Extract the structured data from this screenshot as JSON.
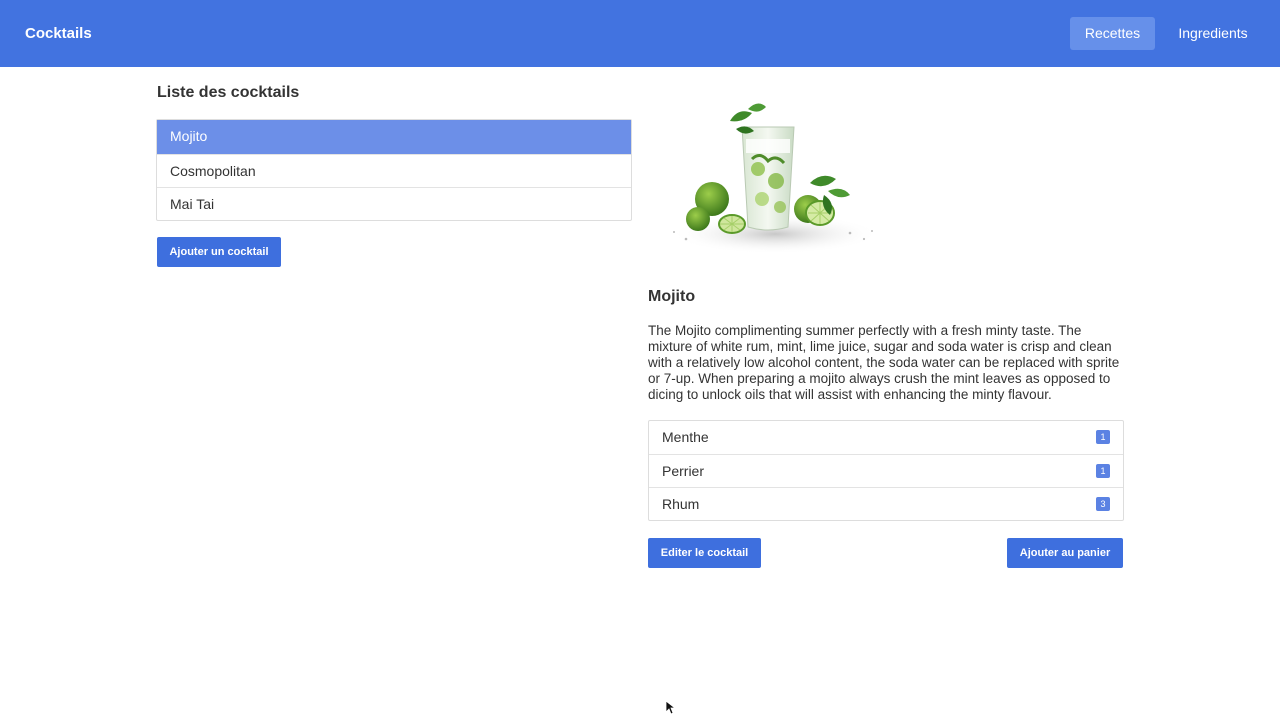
{
  "navbar": {
    "brand": "Cocktails",
    "links": [
      {
        "label": "Recettes",
        "active": true
      },
      {
        "label": "Ingredients",
        "active": false
      }
    ]
  },
  "list": {
    "title": "Liste des cocktails",
    "items": [
      {
        "label": "Mojito",
        "selected": true
      },
      {
        "label": "Cosmopolitan",
        "selected": false
      },
      {
        "label": "Mai Tai",
        "selected": false
      }
    ],
    "add_button": "Ajouter un cocktail"
  },
  "detail": {
    "image_name": "mojito-glass-with-limes",
    "title": "Mojito",
    "description": "The Mojito complimenting summer perfectly with a fresh minty taste. The mixture of white rum, mint, lime juice, sugar and soda water is crisp and clean with a relatively low alcohol content, the soda water can be replaced with sprite or 7-up. When preparing a mojito always crush the mint leaves as opposed to dicing to unlock oils that will assist with enhancing the minty flavour.",
    "ingredients": [
      {
        "name": "Menthe",
        "qty": "1"
      },
      {
        "name": "Perrier",
        "qty": "1"
      },
      {
        "name": "Rhum",
        "qty": "3"
      }
    ],
    "edit_button": "Editer le cocktail",
    "cart_button": "Ajouter au panier"
  },
  "colors": {
    "primary": "#4273e0",
    "selected": "#6c8fe8",
    "badge": "#5b82e3"
  }
}
